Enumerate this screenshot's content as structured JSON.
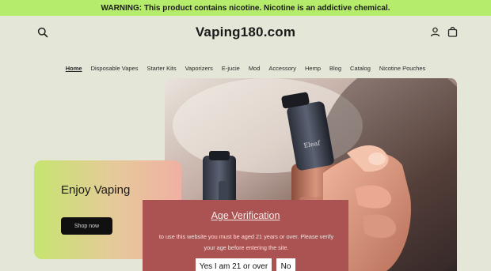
{
  "warning": "WARNING: This product contains nicotine. Nicotine is an addictive chemical.",
  "header": {
    "logo": "Vaping180.com",
    "icons": {
      "search": "search-icon",
      "account": "account-icon",
      "cart": "cart-icon"
    }
  },
  "nav": {
    "items": [
      "Home",
      "Disposable Vapes",
      "Starter Kits",
      "Vaporizers",
      "E-jucie",
      "Mod",
      "Accessory",
      "Hemp",
      "Blog",
      "Catalog",
      "Nicotine Pouches"
    ],
    "active": "Home"
  },
  "hero": {
    "title": "Enjoy Vaping",
    "button": "Shop now"
  },
  "age_verification": {
    "title": "Age Verification",
    "text": "to use this website you must be aged 21 years or over. Please verify your age before entering the site.",
    "yes": "Yes I am 21 or over",
    "no": "No"
  },
  "colors": {
    "warning_bg": "#b5ec6b",
    "page_bg": "#e4e7d8",
    "modal_bg": "#ab5252"
  }
}
